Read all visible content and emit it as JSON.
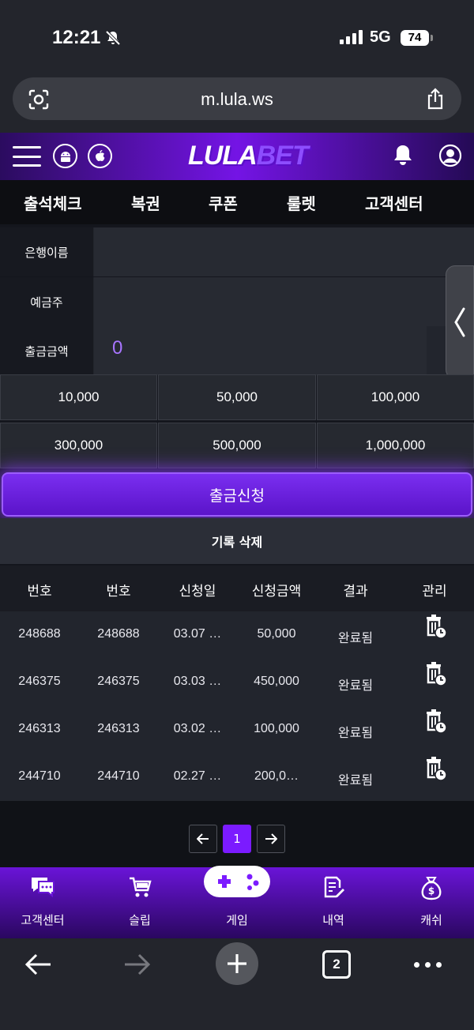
{
  "status_bar": {
    "time": "12:21",
    "network": "5G",
    "battery": "74"
  },
  "browser": {
    "url": "m.lula.ws",
    "tab_count": "2"
  },
  "header": {
    "logo_left": "LULA",
    "logo_right": "BET"
  },
  "nav": [
    "출석체크",
    "복권",
    "쿠폰",
    "룰렛",
    "고객센터"
  ],
  "form": {
    "bank_label": "은행이름",
    "holder_label": "예금주",
    "amount_label": "출금금액",
    "amount_value": "0"
  },
  "amounts": [
    "10,000",
    "50,000",
    "100,000",
    "300,000",
    "500,000",
    "1,000,000"
  ],
  "actions": {
    "submit": "출금신청",
    "delete_history": "기록 삭제"
  },
  "table": {
    "headers": [
      "번호",
      "번호",
      "신청일",
      "신청금액",
      "결과",
      "관리"
    ],
    "rows": [
      {
        "no": "248688",
        "id": "248688",
        "date": "03.07 …",
        "amount": "50,000",
        "result": "완료됨"
      },
      {
        "no": "246375",
        "id": "246375",
        "date": "03.03 …",
        "amount": "450,000",
        "result": "완료됨"
      },
      {
        "no": "246313",
        "id": "246313",
        "date": "03.02 …",
        "amount": "100,000",
        "result": "완료됨"
      },
      {
        "no": "244710",
        "id": "244710",
        "date": "02.27 …",
        "amount": "200,0…",
        "result": "완료됨"
      }
    ]
  },
  "pagination": {
    "current": "1"
  },
  "bottom_nav": [
    "고객센터",
    "슬립",
    "게임",
    "내역",
    "캐쉬"
  ],
  "colors": {
    "accent": "#7b1bff",
    "amount_text": "#a875ff"
  }
}
